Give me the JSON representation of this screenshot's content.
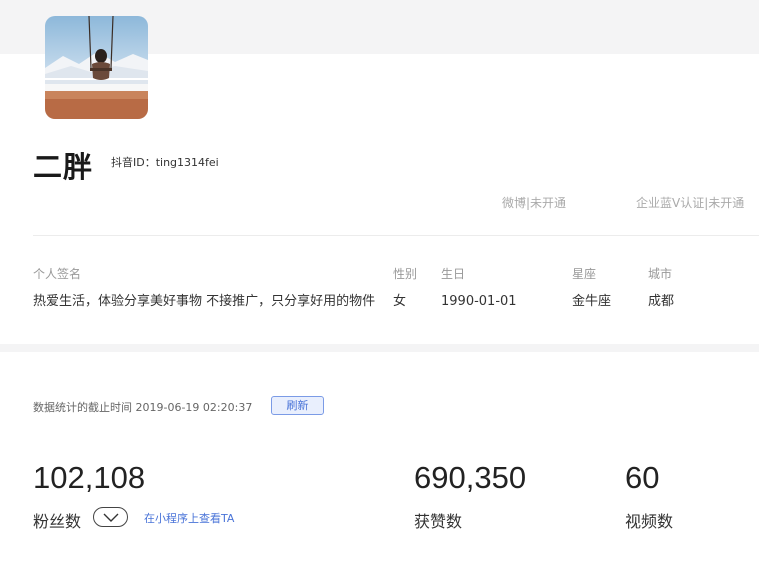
{
  "profile": {
    "name": "二胖",
    "douyin_id": "抖音ID：ting1314fei",
    "weibo": "微博|未开通",
    "enterprise_v": "企业蓝V认证|未开通"
  },
  "info": {
    "signature_label": "个人签名",
    "signature": "热爱生活，体验分享美好事物 不接推广，只分享好用的物件",
    "gender_label": "性别",
    "gender": "女",
    "birthday_label": "生日",
    "birthday": "1990-01-01",
    "zodiac_label": "星座",
    "zodiac": "金牛座",
    "city_label": "城市",
    "city": "成都"
  },
  "stats": {
    "time_label": "数据统计的截止时间 2019-06-19 02:20:37",
    "refresh_label": "刷新",
    "followers": "102,108",
    "followers_label": "粉丝数",
    "mini_program_link": "在小程序上查看TA",
    "likes": "690,350",
    "likes_label": "获赞数",
    "videos": "60",
    "videos_label": "视频数"
  },
  "icons": {
    "avatar": "avatar-photo",
    "chevron": "chevron-down-icon"
  }
}
